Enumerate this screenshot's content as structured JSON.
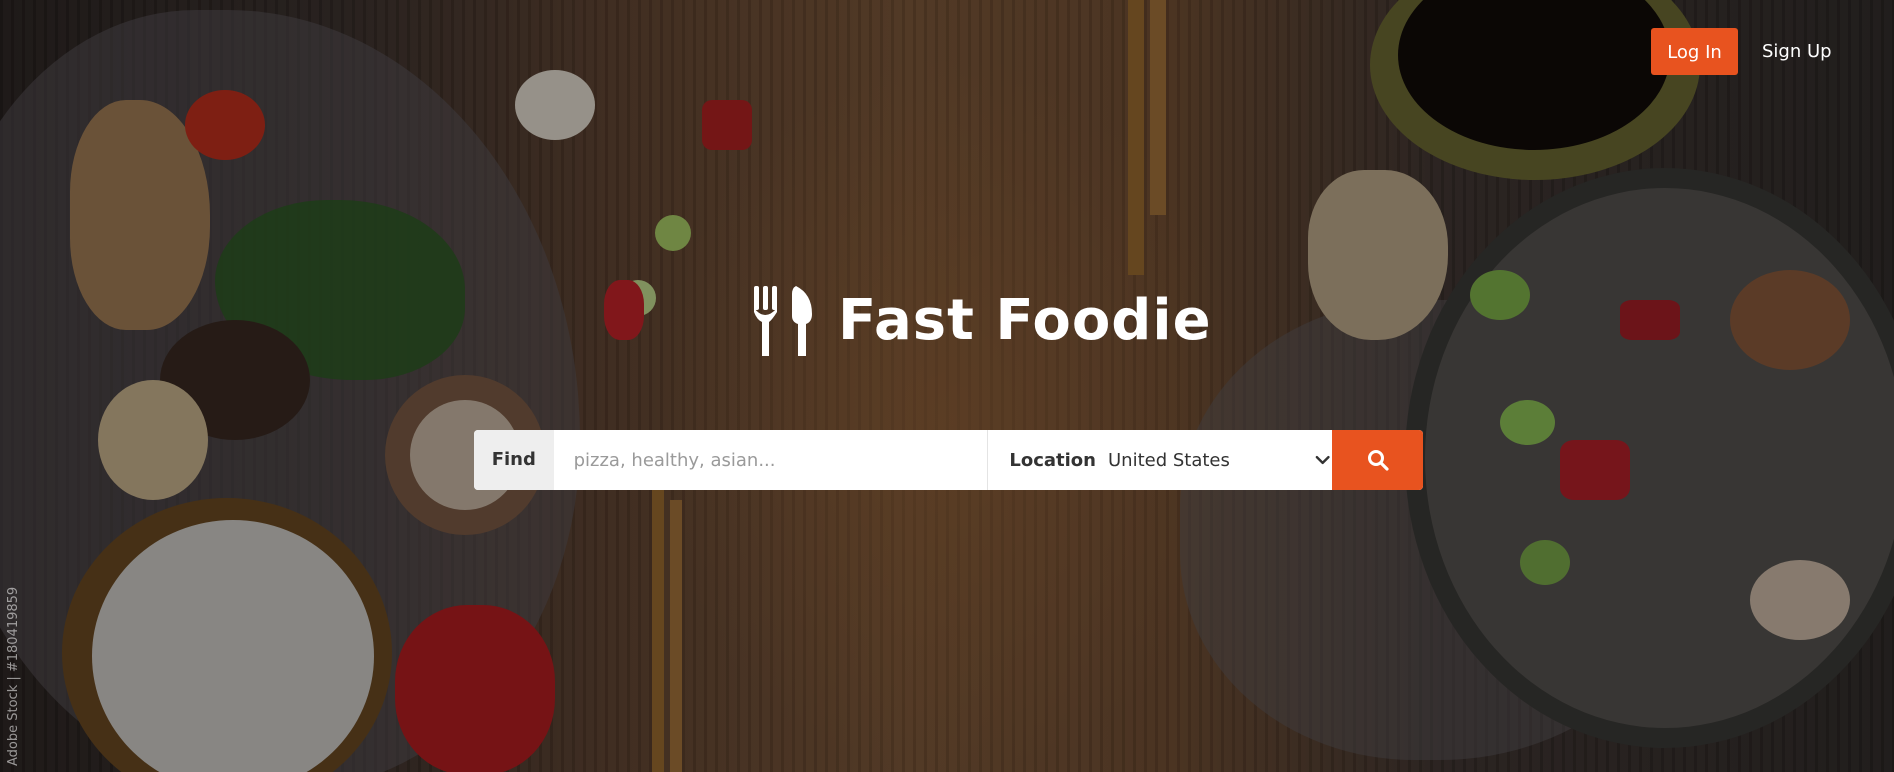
{
  "header": {
    "login_label": "Log In",
    "signup_label": "Sign Up"
  },
  "brand": {
    "name": "Fast Foodie",
    "logo_icon": "fork-knife-icon"
  },
  "search": {
    "find_label": "Find",
    "find_placeholder": "pizza, healthy, asian...",
    "location_label": "Location",
    "location_value": "United States",
    "submit_icon": "search-icon"
  },
  "background": {
    "watermark": "Adobe Stock | #180419859"
  },
  "colors": {
    "accent": "#e8531f",
    "text_light": "#ffffff",
    "text_dark": "#333333"
  }
}
